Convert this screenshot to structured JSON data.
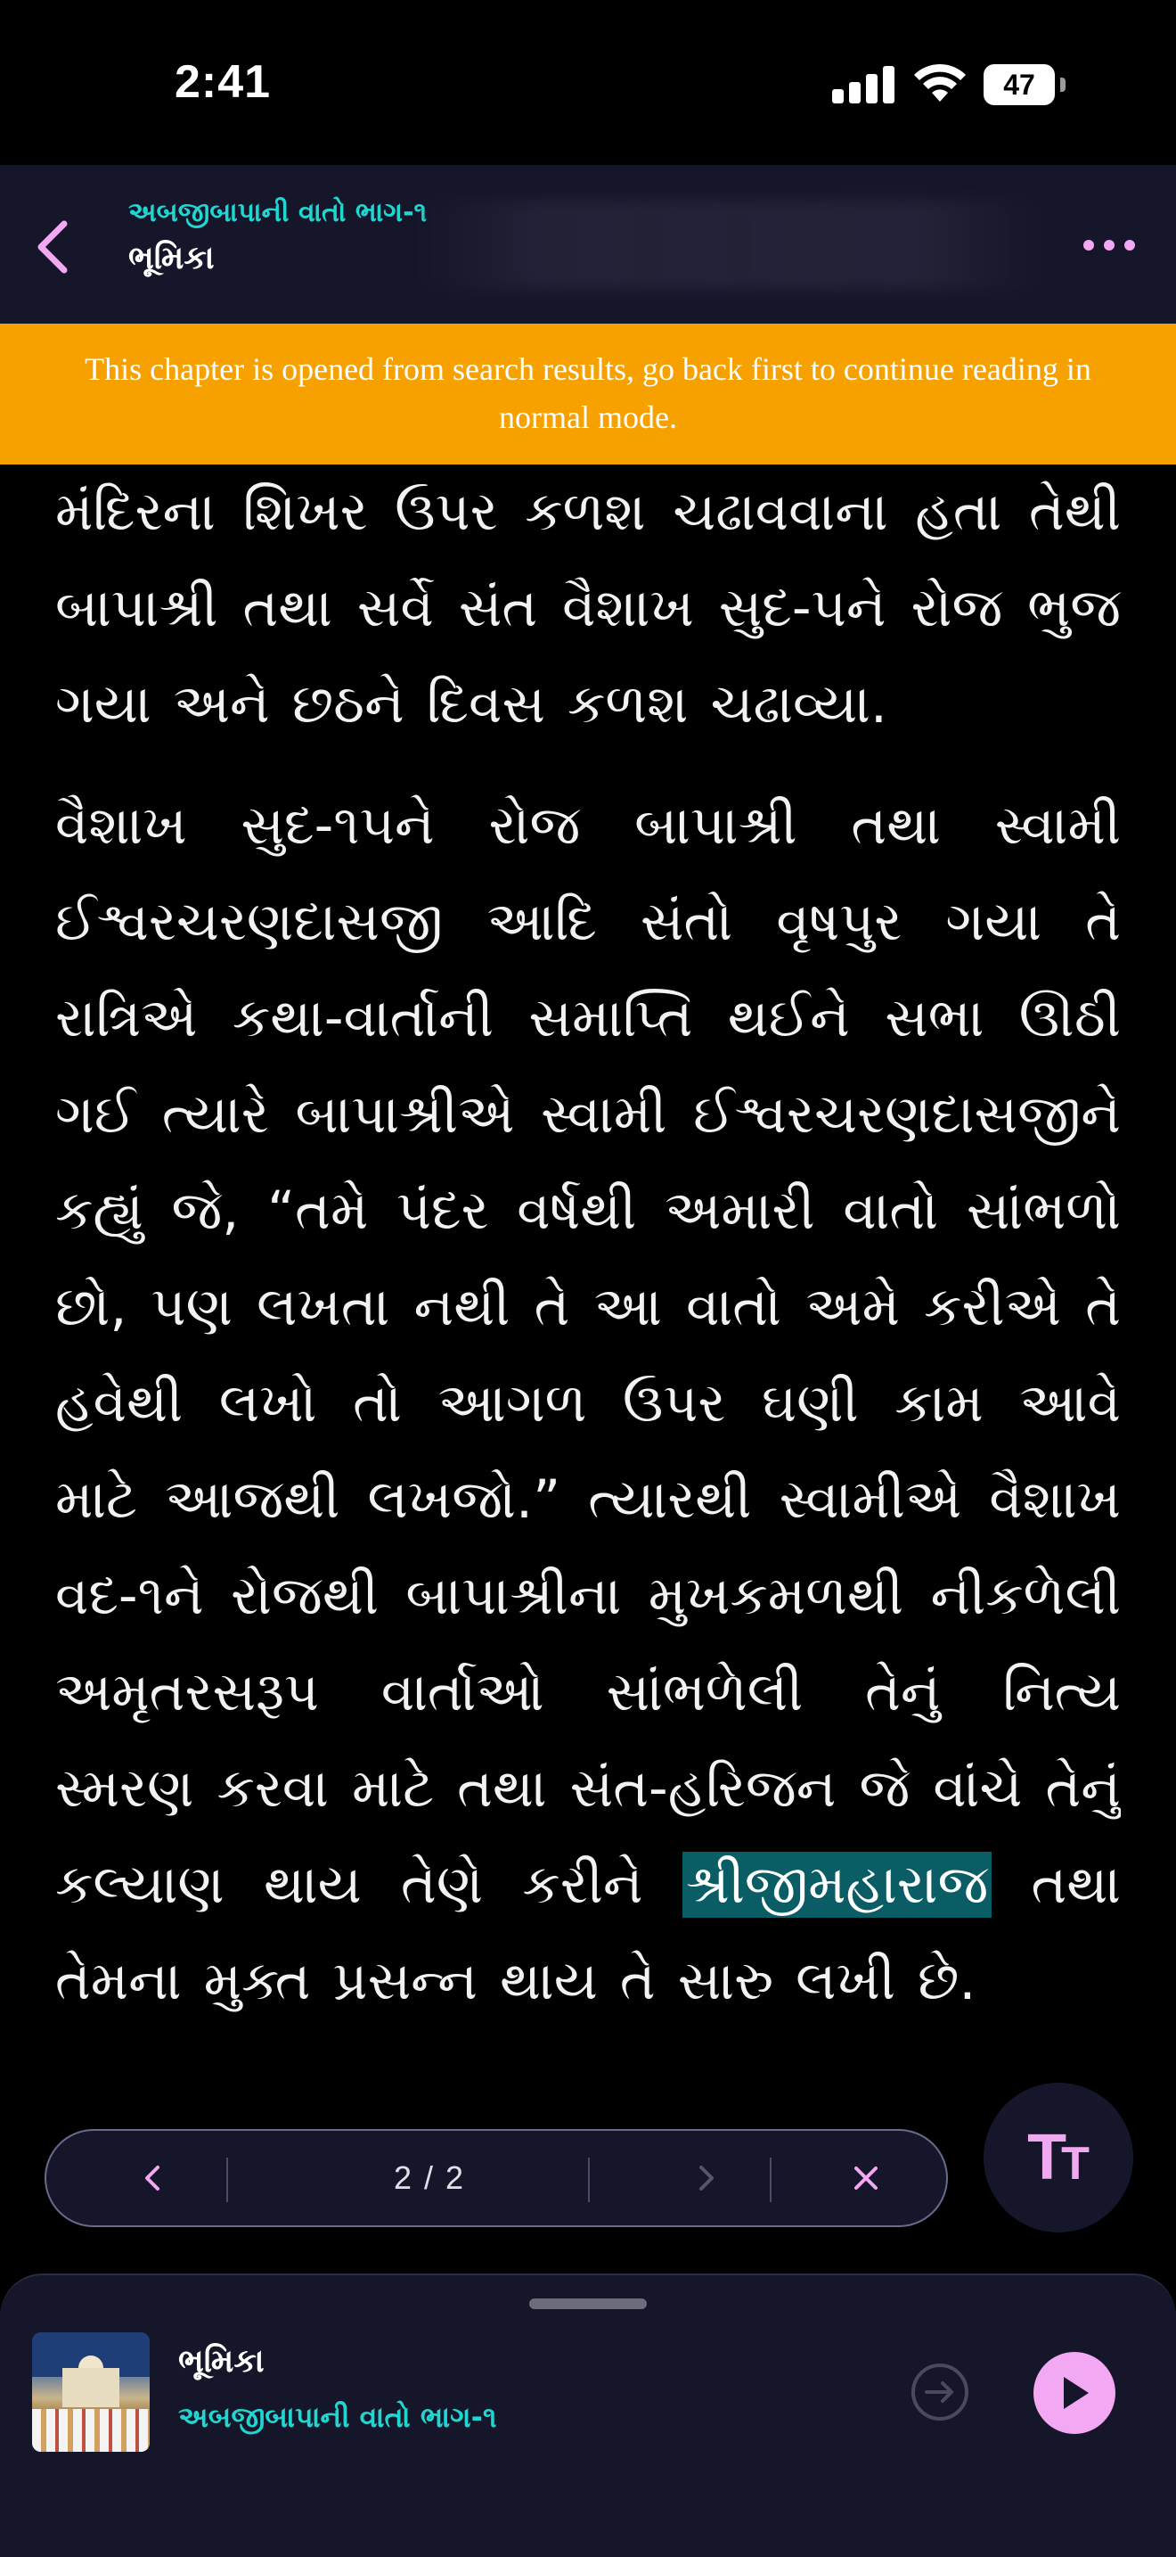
{
  "status_bar": {
    "time": "2:41",
    "battery": "47"
  },
  "header": {
    "book_title": "અબજીબાપાની વાતો ભાગ-૧",
    "chapter_title": "ભૂમિકા"
  },
  "banner": {
    "text": "This chapter is opened from search results, go back first to continue reading in normal mode."
  },
  "content": {
    "paragraph1": "મંદિરના શિખર ઉપર કળશ ચઢાવવાના હતા તેથી બાપાશ્રી તથા સર્વે સંત વૈશાખ સુદ-૫ને રોજ ભુજ ગયા અને છઠને દિવસ કળશ ચઢાવ્યા.",
    "paragraph2_before": "વૈશાખ સુદ-૧૫ને રોજ બાપાશ્રી તથા સ્વામી ઈશ્વરચરણદાસજી આદિ સંતો વૃષપુર ગયા તે રાત્રિએ કથા-વાર્તાની સમાપ્તિ થઈને સભા ઊઠી ગઈ ત્યારે બાપાશ્રીએ સ્વામી ઈશ્વરચરણદાસજીને કહ્યું જે, “તમે પંદર વર્ષથી અમારી વાતો સાંભળો છો, પણ લખતા નથી તે આ વાતો અમે કરીએ તે હવેથી લખો તો આગળ ઉપર ઘણી કામ આવે માટે આજથી લખજો.” ત્યારથી સ્વામીએ વૈશાખ વદ-૧ને રોજથી બાપાશ્રીના મુખકમળથી નીકળેલી અમૃતરસરૂપ વાર્તાઓ સાંભળેલી તેનું નિત્ય સ્મરણ કરવા માટે તથા સંત-હરિજન જે વાંચે તેનું કલ્યાણ થાય તેણે કરીને ",
    "highlight": "શ્રીજીમહારાજ",
    "paragraph2_after": " તથા તેમના મુક્ત પ્રસન્ન થાય તે સારુ લખી છે."
  },
  "search_nav": {
    "count": "2 / 2",
    "icons": [
      "chevron-left-icon",
      "chevron-right-icon",
      "close-icon"
    ]
  },
  "text_size_button": {
    "label_big": "T",
    "label_small": "T"
  },
  "player": {
    "title": "ભૂમિકા",
    "subtitle": "અબજીબાપાની વાતો ભાગ-૧"
  },
  "colors": {
    "accent_cyan": "#1fd6d0",
    "accent_pink": "#f2a8f2",
    "banner_orange": "#f6a100",
    "highlight_teal": "#0b5d65",
    "panel_dark": "#16162a"
  }
}
